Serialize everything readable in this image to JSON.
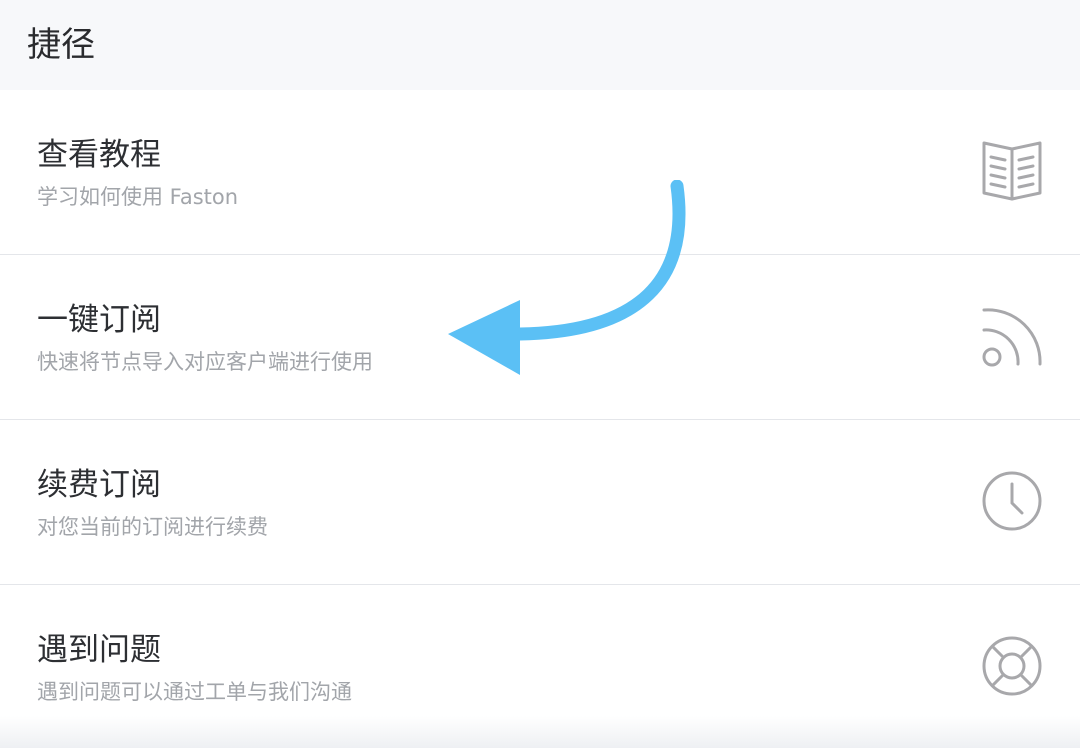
{
  "header": {
    "title": "捷径"
  },
  "items": [
    {
      "title": "查看教程",
      "subtitle": "学习如何使用 Faston",
      "icon": "book-icon"
    },
    {
      "title": "一键订阅",
      "subtitle": "快速将节点导入对应客户端进行使用",
      "icon": "rss-icon"
    },
    {
      "title": "续费订阅",
      "subtitle": "对您当前的订阅进行续费",
      "icon": "clock-icon"
    },
    {
      "title": "遇到问题",
      "subtitle": "遇到问题可以通过工单与我们沟通",
      "icon": "lifebuoy-icon"
    }
  ],
  "colors": {
    "header_bg": "#f7f8fa",
    "title_text": "#2d2f33",
    "subtitle_text": "#a2a5aa",
    "icon_stroke": "#a8a8ab",
    "divider": "#e4e6ea",
    "annotation_arrow": "#5bc0f5"
  },
  "annotation": {
    "icon": "curved-arrow-annotation"
  }
}
